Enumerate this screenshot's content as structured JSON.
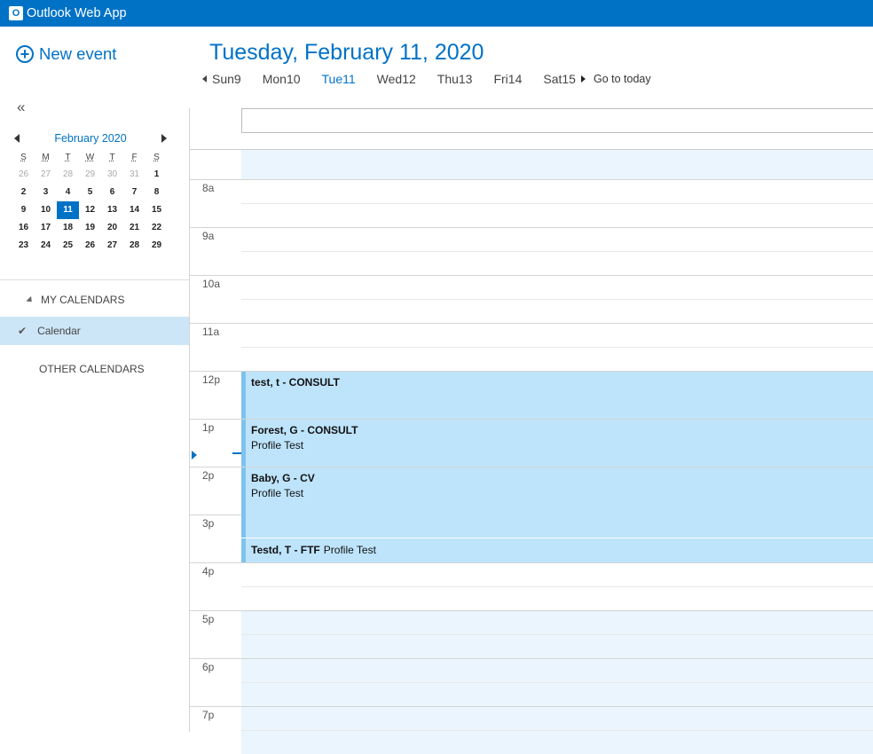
{
  "app": {
    "title": "Outlook Web App",
    "logo_letter": "O"
  },
  "left": {
    "new_event_label": "New event",
    "collapse_glyph": "«",
    "mini_calendar": {
      "month_label": "February 2020",
      "weekdays": [
        "S",
        "M",
        "T",
        "W",
        "T",
        "F",
        "S"
      ],
      "weeks": [
        [
          "26",
          "27",
          "28",
          "29",
          "30",
          "31",
          "1"
        ],
        [
          "2",
          "3",
          "4",
          "5",
          "6",
          "7",
          "8"
        ],
        [
          "9",
          "10",
          "11",
          "12",
          "13",
          "14",
          "15"
        ],
        [
          "16",
          "17",
          "18",
          "19",
          "20",
          "21",
          "22"
        ],
        [
          "23",
          "24",
          "25",
          "26",
          "27",
          "28",
          "29"
        ]
      ],
      "selected_day": "11"
    },
    "my_calendars_label": "MY CALENDARS",
    "calendar_item_label": "Calendar",
    "other_calendars_label": "OTHER CALENDARS"
  },
  "header": {
    "date_title": "Tuesday, February 11, 2020",
    "week_days": [
      "Sun9",
      "Mon10",
      "Tue11",
      "Wed12",
      "Thu13",
      "Fri14",
      "Sat15"
    ],
    "selected_week_day": "Tue11",
    "go_to_today": "Go to today"
  },
  "time_labels": [
    "8a",
    "9a",
    "10a",
    "11a",
    "12p",
    "1p",
    "2p",
    "3p",
    "4p",
    "5p",
    "6p",
    "7p"
  ],
  "events": [
    {
      "title": "test, t - CONSULT",
      "subtitle": ""
    },
    {
      "title": "Forest, G - CONSULT",
      "subtitle": "Profile Test"
    },
    {
      "title": "Baby, G - CV",
      "subtitle": "Profile Test"
    },
    {
      "title": "Testd, T - FTF",
      "subtitle": "Profile Test"
    }
  ],
  "colors": {
    "brand": "#0072c6",
    "event_bg": "#bee4fb",
    "event_accent": "#7ec3ec",
    "off_hours_bg": "#eaf5fd"
  },
  "icons": [
    "outlook-logo-icon",
    "add-circle-icon",
    "collapse-icon",
    "prev-month-icon",
    "next-month-icon",
    "expand-triangle-icon",
    "checkmark-icon",
    "prev-week-icon",
    "next-week-icon",
    "current-time-icon"
  ]
}
